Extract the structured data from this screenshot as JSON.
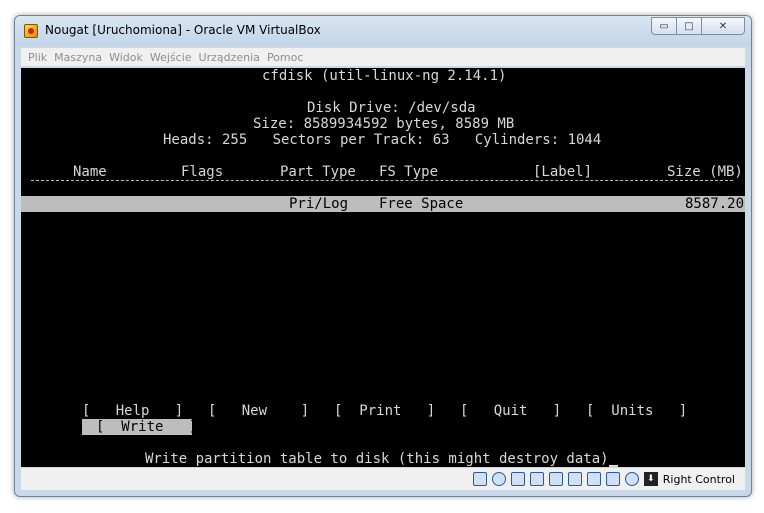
{
  "window": {
    "title": "Nougat [Uruchomiona] - Oracle VM VirtualBox",
    "controls": {
      "minimize": "▭",
      "maximize": "□",
      "close": "✕"
    }
  },
  "menu": [
    "Plik",
    "Maszyna",
    "Widok",
    "Wejście",
    "Urządzenia",
    "Pomoc"
  ],
  "terminal": {
    "header": "cfdisk (util-linux-ng 2.14.1)",
    "disk_drive": "Disk Drive: /dev/sda",
    "size": "Size: 8589934592 bytes, 8589 MB",
    "geometry": "Heads: 255   Sectors per Track: 63   Cylinders: 1044",
    "columns": {
      "name": "Name",
      "flags": "Flags",
      "part_type": "Part Type",
      "fs_type": "FS Type",
      "label": "[Label]",
      "size": "Size (MB)"
    },
    "rows": [
      {
        "part_type": "Pri/Log",
        "fs_type": "Free Space",
        "size": "8587.20"
      }
    ],
    "actions": {
      "help": "[   Help   ]",
      "new": "[   New    ]",
      "print": "[  Print   ]",
      "quit": "[   Quit   ]",
      "units": "[  Units   ]",
      "write": "[  Write   ]"
    },
    "status_message": "Write partition table to disk (this might destroy data)"
  },
  "statusbar": {
    "host_key": "Right Control",
    "icons": [
      "hard-disk-icon",
      "optical-drive-icon",
      "network-icon",
      "usb-icon",
      "shared-folders-icon",
      "display-icon",
      "video-capture-icon",
      "cpu-icon",
      "mouse-integration-icon",
      "host-key-icon"
    ]
  }
}
